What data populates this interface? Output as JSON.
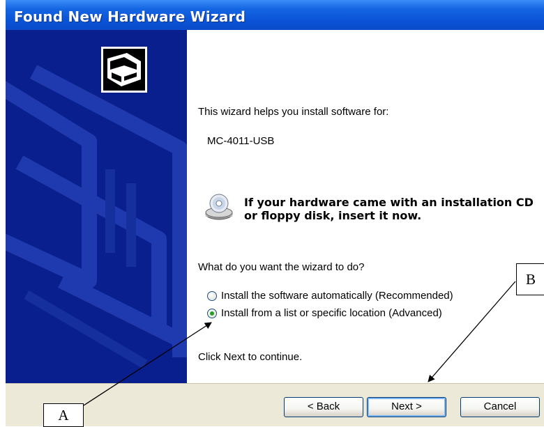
{
  "window": {
    "title": "Found New Hardware Wizard"
  },
  "content": {
    "intro": "This wizard helps you install software for:",
    "device_name": "MC-4011-USB",
    "cd_prompt_line1": "If your hardware came with an installation CD",
    "cd_prompt_line2": "or floppy disk, insert it now.",
    "question": "What do you want the wizard to do?",
    "options": [
      {
        "label": "Install the software automatically (Recommended)",
        "selected": false
      },
      {
        "label": "Install from a list or specific location (Advanced)",
        "selected": true
      }
    ],
    "continue_hint": "Click Next to continue."
  },
  "buttons": {
    "back": "< Back",
    "next": "Next >",
    "cancel": "Cancel"
  },
  "callouts": {
    "a": "A",
    "b": "B"
  },
  "colors": {
    "title_bar": "#0a52d6",
    "left_panel": "#0a1f8e",
    "button_bar": "#ece9d8"
  },
  "icons": {
    "wizard": "hardware-card-icon",
    "cd": "cd-drive-icon"
  }
}
